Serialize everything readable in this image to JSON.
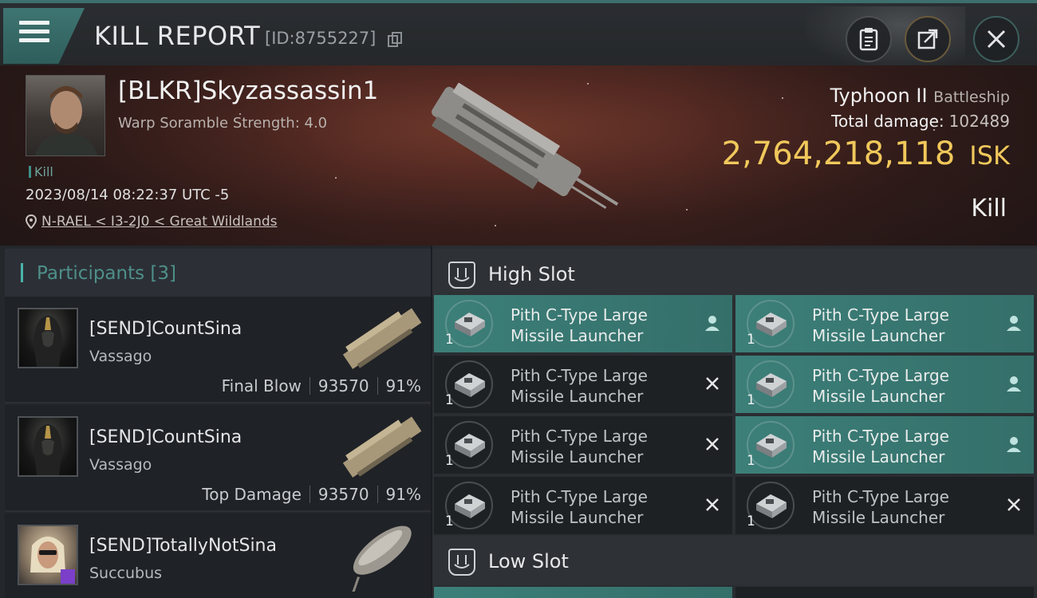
{
  "header": {
    "title": "KILL REPORT",
    "report_id": "[ID:8755227]",
    "icons": [
      "menu-icon",
      "copy-icon",
      "clipboard-icon",
      "share-icon",
      "close-icon"
    ]
  },
  "victim": {
    "name": "[BLKR]Skyzassassin1",
    "sub": "Warp Soramble Strength: 4.0",
    "tag": "Kill",
    "time": "2023/08/14 08:22:37 UTC -5",
    "location": "N-RAEL < I3-2J0 < Great Wildlands",
    "ship_name": "Typhoon II",
    "ship_class": "Battleship",
    "total_damage_label": "Total damage:",
    "total_damage": "102489",
    "isk_value": "2,764,218,118",
    "isk_unit": "ISK",
    "result": "Kill"
  },
  "participants": {
    "label": "Participants",
    "count": "[3]",
    "rows": [
      {
        "name": "[SEND]CountSina",
        "ship": "Vassago",
        "role": "Final Blow",
        "damage": "93570",
        "percent": "91%"
      },
      {
        "name": "[SEND]CountSina",
        "ship": "Vassago",
        "role": "Top Damage",
        "damage": "93570",
        "percent": "91%"
      },
      {
        "name": "[SEND]TotallyNotSina",
        "ship": "Succubus",
        "role": "",
        "damage": "",
        "percent": ""
      }
    ]
  },
  "slots": {
    "high_title": "High Slot",
    "low_title": "Low Slot",
    "high": [
      {
        "line1": "Pith C-Type Large",
        "line2": "Missile Launcher",
        "qty": "1",
        "status": "person"
      },
      {
        "line1": "Pith C-Type Large",
        "line2": "Missile Launcher",
        "qty": "1",
        "status": "person"
      },
      {
        "line1": "Pith C-Type Large",
        "line2": "Missile Launcher",
        "qty": "1",
        "status": "x"
      },
      {
        "line1": "Pith C-Type Large",
        "line2": "Missile Launcher",
        "qty": "1",
        "status": "person"
      },
      {
        "line1": "Pith C-Type Large",
        "line2": "Missile Launcher",
        "qty": "1",
        "status": "x"
      },
      {
        "line1": "Pith C-Type Large",
        "line2": "Missile Launcher",
        "qty": "1",
        "status": "person"
      },
      {
        "line1": "Pith C-Type Large",
        "line2": "Missile Launcher",
        "qty": "1",
        "status": "x"
      },
      {
        "line1": "Pith C-Type Large",
        "line2": "Missile Launcher",
        "qty": "1",
        "status": "x"
      }
    ]
  },
  "colors": {
    "accent": "#3c7f79",
    "isk": "#f0c85b",
    "bg": "#1b1d21"
  }
}
